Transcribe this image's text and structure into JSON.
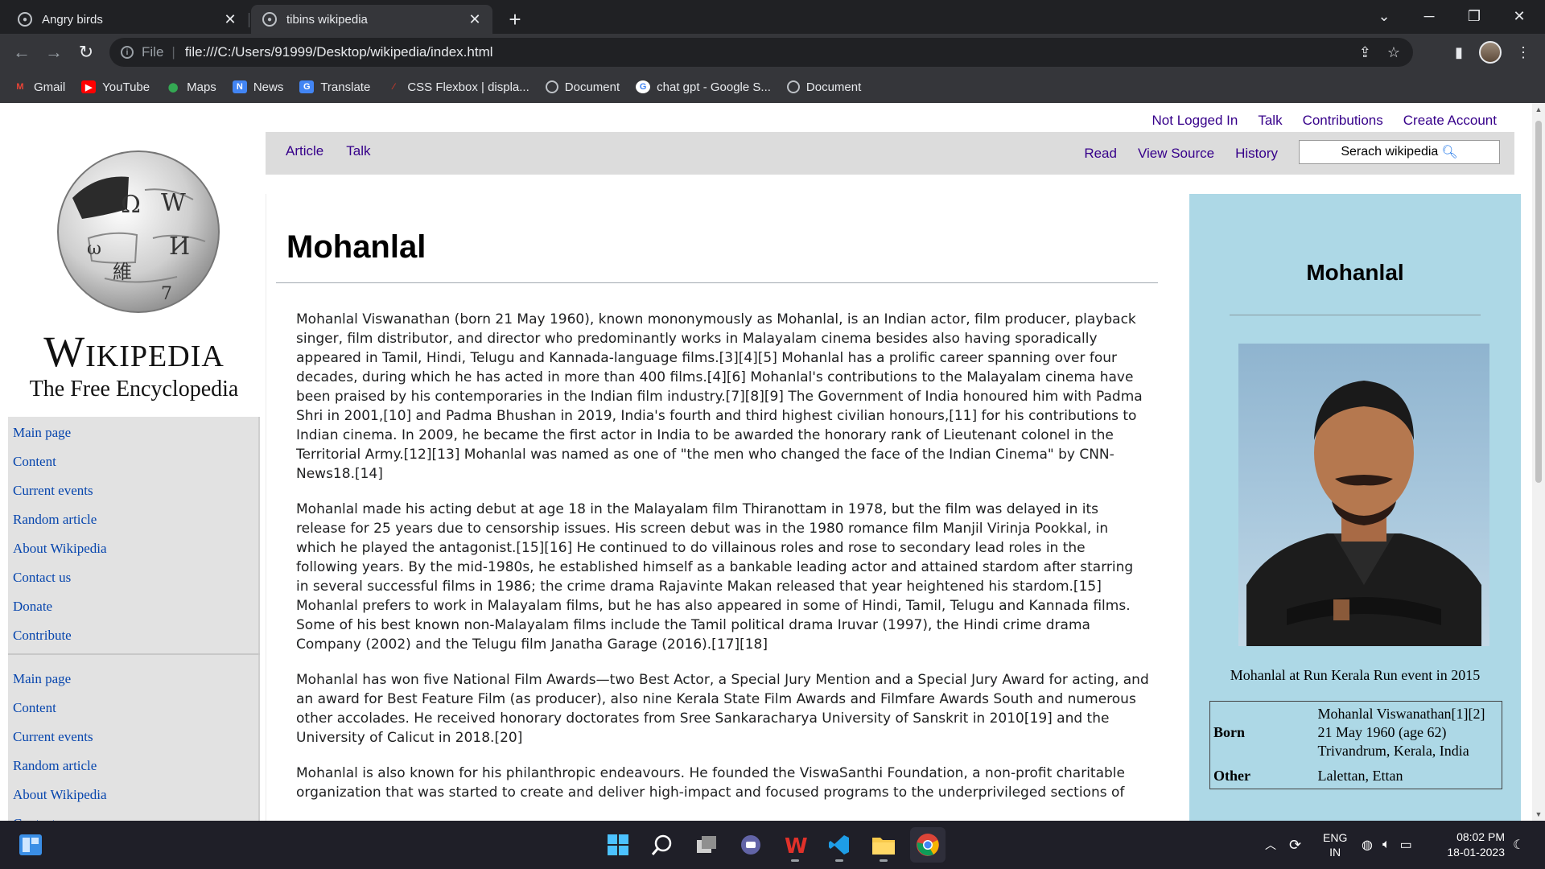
{
  "browser": {
    "tabs": [
      {
        "title": "Angry birds",
        "active": false
      },
      {
        "title": "tibins wikipedia",
        "active": true
      }
    ],
    "url_scheme": "File",
    "url": "file:///C:/Users/91999/Desktop/wikipedia/index.html",
    "bookmarks": [
      {
        "label": "Gmail",
        "icon": "gmail-icon",
        "color": "#ea4335"
      },
      {
        "label": "YouTube",
        "icon": "youtube-icon",
        "color": "#ff0000"
      },
      {
        "label": "Maps",
        "icon": "maps-icon",
        "color": "#34a853"
      },
      {
        "label": "News",
        "icon": "news-icon",
        "color": "#4285f4"
      },
      {
        "label": "Translate",
        "icon": "translate-icon",
        "color": "#4285f4"
      },
      {
        "label": "CSS Flexbox | displa...",
        "icon": "css-icon",
        "color": "#c0392b"
      },
      {
        "label": "Document",
        "icon": "globe-icon",
        "color": "#bdc1c6"
      },
      {
        "label": "chat gpt - Google S...",
        "icon": "google-icon",
        "color": "#ffffff"
      },
      {
        "label": "Document",
        "icon": "globe-icon",
        "color": "#bdc1c6"
      }
    ]
  },
  "wiki": {
    "wordmark": "Wikipedia",
    "tagline": "The Free Encyclopedia",
    "nav_primary": [
      "Main page",
      "Content",
      "Current events",
      "Random article",
      "About Wikipedia",
      "Contact us",
      "Donate",
      "Contribute"
    ],
    "nav_secondary": [
      "Main page",
      "Content",
      "Current events",
      "Random article",
      "About Wikipedia",
      "Contact us"
    ],
    "personal_links": [
      "Not Logged In",
      "Talk",
      "Contributions",
      "Create Account"
    ],
    "page_tabs": [
      "Article",
      "Talk"
    ],
    "view_tabs": [
      "Read",
      "View Source",
      "History"
    ],
    "search_label": "Serach wikipedia"
  },
  "article": {
    "title": "Mohanlal",
    "paragraphs": [
      "Mohanlal Viswanathan (born 21 May 1960), known mononymously as Mohanlal, is an Indian actor, film producer, playback singer, film distributor, and director who predominantly works in Malayalam cinema besides also having sporadically appeared in Tamil, Hindi, Telugu and Kannada-language films.[3][4][5] Mohanlal has a prolific career spanning over four decades, during which he has acted in more than 400 films.[4][6] Mohanlal's contributions to the Malayalam cinema have been praised by his contemporaries in the Indian film industry.[7][8][9] The Government of India honoured him with Padma Shri in 2001,[10] and Padma Bhushan in 2019, India's fourth and third highest civilian honours,[11] for his contributions to Indian cinema. In 2009, he became the first actor in India to be awarded the honorary rank of Lieutenant colonel in the Territorial Army.[12][13] Mohanlal was named as one of \"the men who changed the face of the Indian Cinema\" by CNN-News18.[14]",
      "Mohanlal made his acting debut at age 18 in the Malayalam film Thiranottam in 1978, but the film was delayed in its release for 25 years due to censorship issues. His screen debut was in the 1980 romance film Manjil Virinja Pookkal, in which he played the antagonist.[15][16] He continued to do villainous roles and rose to secondary lead roles in the following years. By the mid-1980s, he established himself as a bankable leading actor and attained stardom after starring in several successful films in 1986; the crime drama Rajavinte Makan released that year heightened his stardom.[15] Mohanlal prefers to work in Malayalam films, but he has also appeared in some of Hindi, Tamil, Telugu and Kannada films. Some of his best known non-Malayalam films include the Tamil political drama Iruvar (1997), the Hindi crime drama Company (2002) and the Telugu film Janatha Garage (2016).[17][18]",
      "Mohanlal has won five National Film Awards—two Best Actor, a Special Jury Mention and a Special Jury Award for acting, and an award for Best Feature Film (as producer), also nine Kerala State Film Awards and Filmfare Awards South and numerous other accolades. He received honorary doctorates from Sree Sankaracharya University of Sanskrit in 2010[19] and the University of Calicut in 2018.[20]",
      "Mohanlal is also known for his philanthropic endeavours. He founded the ViswaSanthi Foundation, a non-profit charitable organization that was started to create and deliver high-impact and focused programs to the underprivileged sections of"
    ]
  },
  "infobox": {
    "title": "Mohanlal",
    "caption": "Mohanlal at Run Kerala Run event in 2015",
    "born_label": "Born",
    "born_value": "Mohanlal Viswanathan[1][2] 21 May 1960 (age 62) Trivandrum, Kerala, India",
    "other_label": "Other",
    "other_value": "Lalettan, Ettan"
  },
  "taskbar": {
    "lang_line1": "ENG",
    "lang_line2": "IN",
    "time": "08:02 PM",
    "date": "18-01-2023"
  }
}
